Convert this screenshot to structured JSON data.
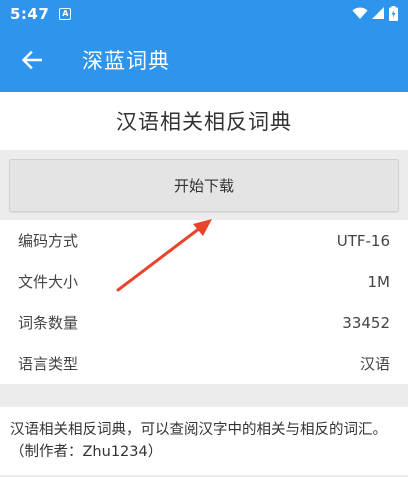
{
  "status_bar": {
    "time": "5:47",
    "notification_icon": "A"
  },
  "app_bar": {
    "title": "深蓝词典",
    "back_icon": "arrow-left-icon"
  },
  "dictionary": {
    "title": "汉语相关相反词典",
    "download_label": "开始下载",
    "info": [
      {
        "label": "编码方式",
        "value": "UTF-16"
      },
      {
        "label": "文件大小",
        "value": "1M"
      },
      {
        "label": "词条数量",
        "value": "33452"
      },
      {
        "label": "语言类型",
        "value": "汉语"
      }
    ],
    "description": "汉语相关相反词典，可以查阅汉字中的相关与相反的词汇。（制作者：Zhu1234）"
  },
  "colors": {
    "primary": "#2f94ec",
    "annotation_arrow": "#e8452c"
  }
}
